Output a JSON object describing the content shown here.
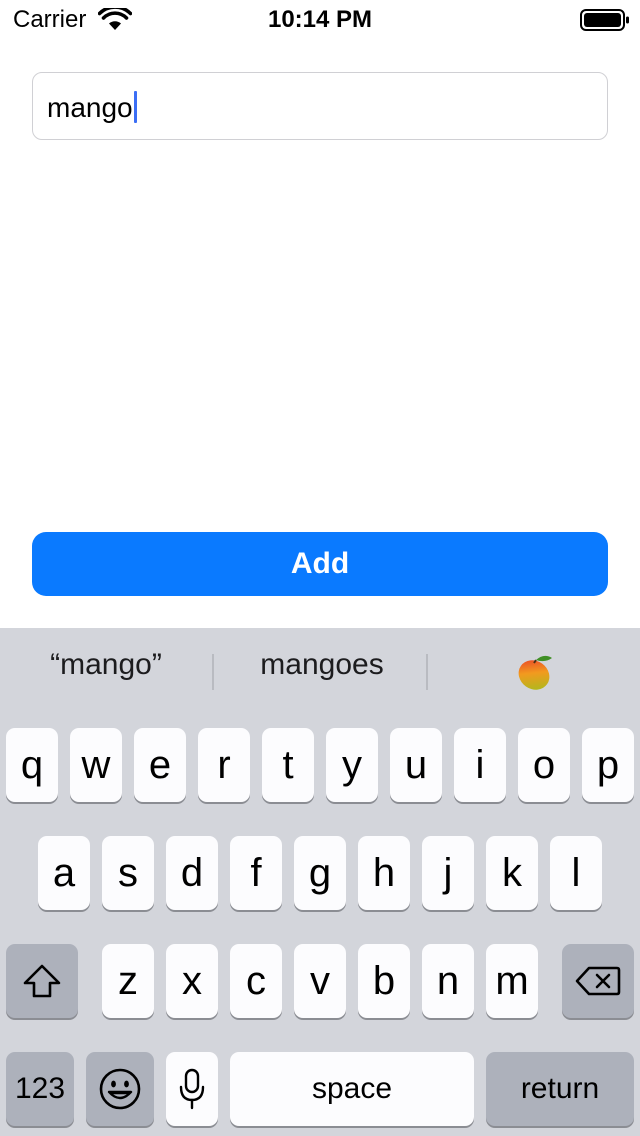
{
  "status_bar": {
    "carrier": "Carrier",
    "time": "10:14 PM",
    "icons": [
      "wifi-icon",
      "battery-icon"
    ]
  },
  "text_field": {
    "value": "mango"
  },
  "add_button": {
    "label": "Add",
    "color": "#0a7aff"
  },
  "keyboard": {
    "suggestions": [
      "“mango”",
      "mangoes"
    ],
    "suggestion_emoji": "mango-emoji-icon",
    "rows": [
      [
        "q",
        "w",
        "e",
        "r",
        "t",
        "y",
        "u",
        "i",
        "o",
        "p"
      ],
      [
        "a",
        "s",
        "d",
        "f",
        "g",
        "h",
        "j",
        "k",
        "l"
      ],
      [
        "z",
        "x",
        "c",
        "v",
        "b",
        "n",
        "m"
      ]
    ],
    "shift_icon": "shift-icon",
    "delete_icon": "delete-icon",
    "numbers_label": "123",
    "emoji_icon": "emoji-icon",
    "mic_icon": "microphone-icon",
    "space_label": "space",
    "return_label": "return"
  }
}
